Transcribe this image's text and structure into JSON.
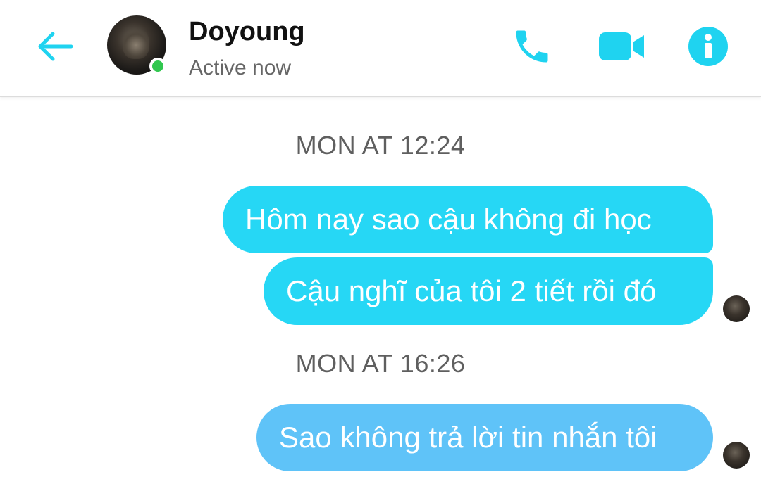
{
  "header": {
    "contact_name": "Doyoung",
    "status": "Active now",
    "online_color": "#31c74f",
    "accent_color": "#1fd3f0",
    "icons": [
      "back-arrow-icon",
      "phone-icon",
      "video-camera-icon",
      "info-icon"
    ]
  },
  "messages": {
    "timestamp_1": "MON AT 12:24",
    "msg_1": "Hôm nay sao cậu không đi học",
    "msg_2": "Cậu nghĩ của tôi 2 tiết rồi đó",
    "timestamp_2": "MON AT 16:26",
    "msg_3": "Sao không trả lời tin nhắn tôi",
    "bubble_color_primary": "#26d7f5",
    "bubble_color_last": "#5fc3f8"
  }
}
